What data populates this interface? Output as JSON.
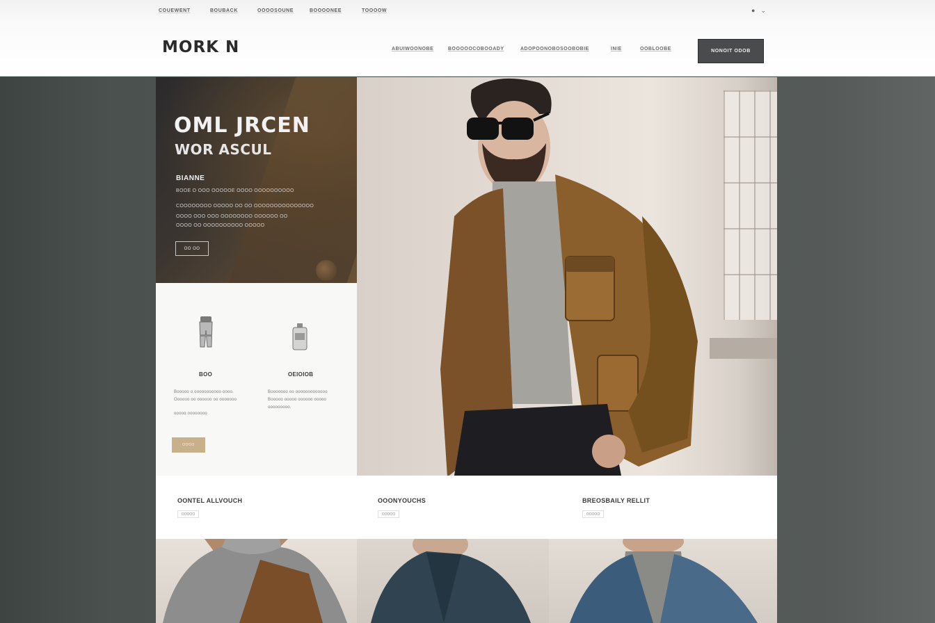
{
  "header": {
    "utility_links": [
      "COUEWENT",
      "BOUBACK",
      "OOOOSOUNE",
      "BOOOONEE",
      "TOOOOW"
    ],
    "utility_icons": [
      "user-icon",
      "chevron-down-icon"
    ],
    "logo": "MORK N",
    "nav": [
      "ABUIWOONOBE",
      "BOOOOOCOBOOADY",
      "ADOPOONOBOSOOBOBIE",
      "INIE",
      "OOBLOOBE"
    ],
    "cta_label": "NONOIT ODOB"
  },
  "hero": {
    "title": "OML JRCEN",
    "subtitle": "WOR ASCUL",
    "label": "BIANNE",
    "lines": [
      "BOOE O OOO OOOOOE OOOO OOOOOOOOOO",
      "COOOOOOOO OOOOO OO OO OOOOOOOOOOOOOOO",
      "OOOO OOO OOO OOOOOOOO OOOOOO OO",
      "OOOO OO OOOOOOOOOO OOOOO"
    ],
    "button_label": "OO OO"
  },
  "features": [
    {
      "icon": "pants-icon",
      "title": "BOO",
      "lines": [
        "Booooo o ooooooooooo oooo.",
        "Oooooo oo oooooo oo ooooooo",
        "ooooo oooooooo"
      ]
    },
    {
      "icon": "bottle-icon",
      "title": "OEIOIOB",
      "lines": [
        "Booooooo oo ooooooooooooo",
        "Booooo ooooo oooooo ooooo",
        "ooooooooo."
      ]
    }
  ],
  "features_button": "OOOO",
  "categories": [
    {
      "title": "OONTEL ALLVOUCH",
      "link": "OOOOO"
    },
    {
      "title": "OOONYOUCHS",
      "link": "OOOOO"
    },
    {
      "title": "BREOSBAILY RELLIT",
      "link": "OOOOO"
    }
  ],
  "colors": {
    "background": "#4b514f",
    "cta": "#4a4b4d",
    "accent": "#c8b08a",
    "leather": "#8a5f2b"
  }
}
